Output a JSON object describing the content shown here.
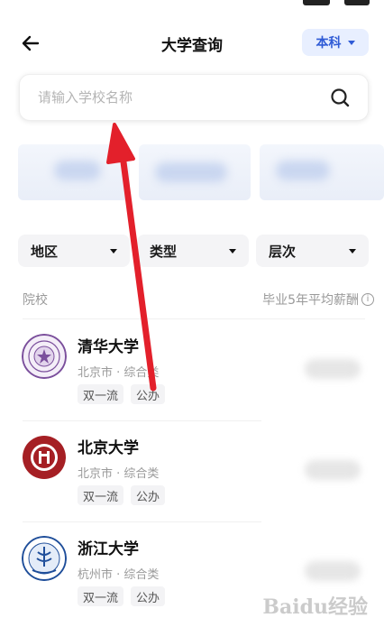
{
  "header": {
    "title": "大学查询",
    "level_select": "本科"
  },
  "search": {
    "placeholder": "请输入学校名称"
  },
  "filters": [
    {
      "label": "地区"
    },
    {
      "label": "类型"
    },
    {
      "label": "层次"
    }
  ],
  "list_header": {
    "left": "院校",
    "right": "毕业5年平均薪酬",
    "info_glyph": "i"
  },
  "universities": [
    {
      "name": "清华大学",
      "meta": "北京市 · 综合类",
      "tags": [
        "双一流",
        "公办"
      ],
      "logo_color": "#7b4f9c"
    },
    {
      "name": "北京大学",
      "meta": "北京市 · 综合类",
      "tags": [
        "双一流",
        "公办"
      ],
      "logo_color": "#a51f24"
    },
    {
      "name": "浙江大学",
      "meta": "杭州市 · 综合类",
      "tags": [
        "双一流",
        "公办"
      ],
      "logo_color": "#1f4e9a"
    }
  ],
  "watermark": "Baidu经验",
  "colors": {
    "accent": "#2f5bd6",
    "accent_bg": "#e8efff",
    "annotation_arrow": "#e3202b"
  }
}
